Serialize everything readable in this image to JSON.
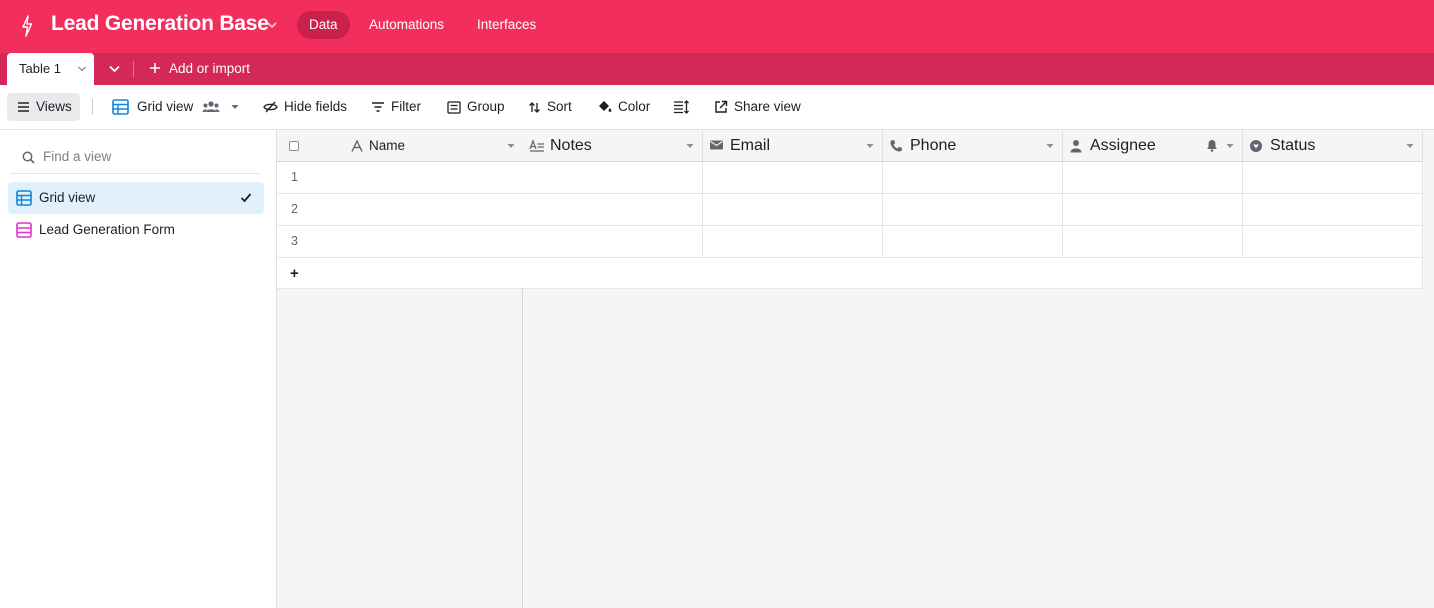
{
  "app": {
    "base_title": "Lead Generation Base",
    "nav": [
      "Data",
      "Automations",
      "Interfaces"
    ],
    "active_nav": "Data",
    "brand_color": "#f22e5d",
    "tabbar_color": "#d42857"
  },
  "tabs": {
    "active_table": "Table 1",
    "add_import": "Add or import"
  },
  "toolbar": {
    "views": "Views",
    "grid_view": "Grid view",
    "hide_fields": "Hide fields",
    "filter": "Filter",
    "group": "Group",
    "sort": "Sort",
    "color": "Color",
    "share_view": "Share view"
  },
  "sidebar": {
    "search_placeholder": "Find a view",
    "views": [
      {
        "label": "Grid view",
        "icon": "grid-icon",
        "active": true
      },
      {
        "label": "Lead Generation Form",
        "icon": "form-icon",
        "active": false
      }
    ]
  },
  "grid": {
    "primary_field": {
      "label": "Name",
      "icon": "text-icon"
    },
    "fields": [
      {
        "label": "Notes",
        "icon": "long-text-icon"
      },
      {
        "label": "Email",
        "icon": "email-icon"
      },
      {
        "label": "Phone",
        "icon": "phone-icon"
      },
      {
        "label": "Assignee",
        "icon": "user-icon"
      },
      {
        "label": "Status",
        "icon": "single-select-icon"
      }
    ],
    "rows": [
      "1",
      "2",
      "3"
    ],
    "add_row": "+"
  }
}
